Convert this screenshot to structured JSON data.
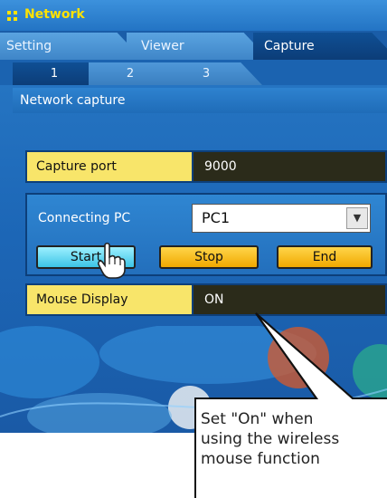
{
  "window": {
    "title": "Network"
  },
  "tabs": [
    "Setting",
    "Viewer",
    "Capture"
  ],
  "active_tab": "Capture",
  "subtabs": [
    "1",
    "2",
    "3"
  ],
  "active_subtab": "1",
  "section": {
    "title": "Network capture"
  },
  "capture_port": {
    "label": "Capture port",
    "value": "9000"
  },
  "connecting_pc": {
    "label": "Connecting PC",
    "value": "PC1"
  },
  "buttons": {
    "start": "Start",
    "stop": "Stop",
    "end": "End"
  },
  "mouse_display": {
    "label": "Mouse Display",
    "value": "ON"
  },
  "callout": {
    "lines": [
      "Set \"On\" when",
      "using the wireless",
      "mouse function"
    ]
  },
  "colors": {
    "title": "#ffe200",
    "row_label_bg": "#f8e56a",
    "value_bg": "#2b2b1a",
    "start_button": "#3cc4e6",
    "stop_end_button": "#f0a800"
  },
  "icons": [
    "grid-icon",
    "dropdown-arrow-icon",
    "hand-pointer-icon"
  ]
}
